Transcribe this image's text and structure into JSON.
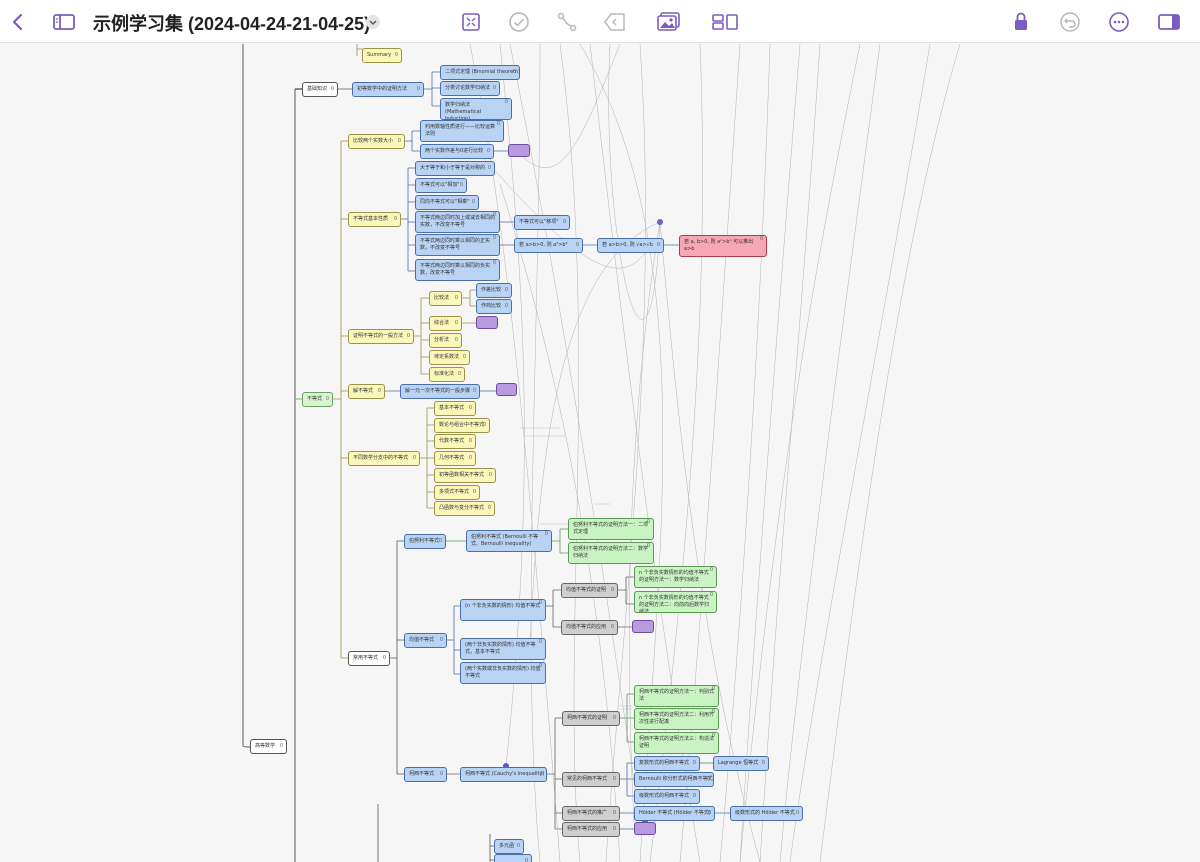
{
  "toolbar": {
    "title": "示例学习集 (2024-04-24-21-04-25)",
    "icons": [
      "chevron-left-icon",
      "sidebar-icon",
      "chevron-down-icon",
      "collapse-icon",
      "check-icon",
      "connect-icon",
      "back-icon",
      "image-icon",
      "layout-icon",
      "lock-icon",
      "undo-icon",
      "more-icon",
      "panel-icon"
    ],
    "accent": "#7b5cc4"
  },
  "nodes": [
    {
      "id": "summary",
      "label": "Summary",
      "count": "0",
      "color": "yellow"
    },
    {
      "id": "basic",
      "label": "基础知识",
      "count": "0",
      "color": "white"
    },
    {
      "id": "proofmethods",
      "label": "初等数学中的证明方法",
      "count": "0",
      "color": "blue"
    },
    {
      "id": "binomial",
      "label": "二项式定理 (Binomial theorem)",
      "count": "0",
      "color": "blue"
    },
    {
      "id": "mathind_list",
      "label": "分类讨论数学归纳法",
      "count": "0",
      "color": "blue"
    },
    {
      "id": "mathind",
      "label": "数学归纳法 (Mathematical induction)",
      "count": "0",
      "color": "blue"
    },
    {
      "id": "compare",
      "label": "比较两个实数大小",
      "count": "0",
      "color": "yellow"
    },
    {
      "id": "cmp1",
      "label": "利用数轴性质进行——比较运算法则",
      "count": "0",
      "color": "blue"
    },
    {
      "id": "cmp2",
      "label": "两个实数作差与0进行比较",
      "count": "0",
      "color": "blue"
    },
    {
      "id": "prop",
      "label": "不等式基本性质",
      "count": "0",
      "color": "yellow"
    },
    {
      "id": "p1",
      "label": "大于等于和小于等于是对称的",
      "count": "0",
      "color": "blue"
    },
    {
      "id": "p2",
      "label": "不等式可以\"相加\"",
      "count": "0",
      "color": "blue"
    },
    {
      "id": "p3",
      "label": "同向不等式可以\"相乘\"",
      "count": "0",
      "color": "blue"
    },
    {
      "id": "p4",
      "label": "不等式两边同时加上或减去相同的实数，不改变不等号",
      "count": "0",
      "color": "blue"
    },
    {
      "id": "p4r",
      "label": "不等式可以\"移项\"",
      "count": "0",
      "color": "blue"
    },
    {
      "id": "p5",
      "label": "不等式两边同时乘以相同的正实数，不改变不等号",
      "count": "0",
      "color": "blue"
    },
    {
      "id": "p5a",
      "label": "若 a>b>0, 则 a²>b²",
      "count": "0",
      "color": "blue"
    },
    {
      "id": "p5b",
      "label": "若 a>b>0, 则 √a>√b",
      "count": "0",
      "color": "blue"
    },
    {
      "id": "p5c",
      "label": "若 a, b>0, 则 aⁿ>bⁿ 可以推出 a>b",
      "count": "0",
      "color": "pink"
    },
    {
      "id": "p6",
      "label": "不等式两边同时乘以相同的负实数，改变不等号",
      "count": "0",
      "color": "blue"
    },
    {
      "id": "general",
      "label": "证明不等式的一般方法",
      "count": "0",
      "color": "yellow"
    },
    {
      "id": "g1",
      "label": "比较法",
      "count": "0",
      "color": "yellow"
    },
    {
      "id": "g1a",
      "label": "作差比较",
      "count": "0",
      "color": "blue"
    },
    {
      "id": "g1b",
      "label": "作商比较",
      "count": "0",
      "color": "blue"
    },
    {
      "id": "g2",
      "label": "综合法",
      "count": "0",
      "color": "yellow"
    },
    {
      "id": "g3",
      "label": "分析法",
      "count": "0",
      "color": "yellow"
    },
    {
      "id": "g4",
      "label": "待定系数法",
      "count": "0",
      "color": "yellow"
    },
    {
      "id": "g5",
      "label": "标准化法",
      "count": "0",
      "color": "yellow"
    },
    {
      "id": "ineq",
      "label": "不等式",
      "count": "0",
      "color": "lgreen"
    },
    {
      "id": "solve",
      "label": "解不等式",
      "count": "0",
      "color": "yellow"
    },
    {
      "id": "solve1",
      "label": "解一元一次不等式的一般步骤",
      "count": "0",
      "color": "blue"
    },
    {
      "id": "branches",
      "label": "不同数学分支中的不等式",
      "count": "0",
      "color": "yellow"
    },
    {
      "id": "b1",
      "label": "基本不等式",
      "count": "0",
      "color": "yellow"
    },
    {
      "id": "b2",
      "label": "数论与组合中不等式",
      "count": "0",
      "color": "yellow"
    },
    {
      "id": "b3",
      "label": "代数不等式",
      "count": "0",
      "color": "yellow"
    },
    {
      "id": "b4",
      "label": "几何不等式",
      "count": "0",
      "color": "yellow"
    },
    {
      "id": "b5",
      "label": "初等函数相关不等式",
      "count": "0",
      "color": "yellow"
    },
    {
      "id": "b6",
      "label": "多项式不等式",
      "count": "0",
      "color": "yellow"
    },
    {
      "id": "b7",
      "label": "凸函数与变分不等式",
      "count": "0",
      "color": "yellow"
    },
    {
      "id": "common",
      "label": "常用不等式",
      "count": "0",
      "color": "white"
    },
    {
      "id": "bern",
      "label": "伯努利不等式",
      "count": "0",
      "color": "blue"
    },
    {
      "id": "bern1",
      "label": "伯努利不等式 (Bernoulli 不等式、Bernoulli inequality)",
      "count": "0",
      "color": "blue"
    },
    {
      "id": "bern2",
      "label": "伯努利不等式的证明方法一：二项式定理",
      "count": "0",
      "color": "green"
    },
    {
      "id": "bern3",
      "label": "伯努利不等式的证明方法二：数学归纳法",
      "count": "0",
      "color": "green"
    },
    {
      "id": "mean",
      "label": "均值不等式",
      "count": "0",
      "color": "blue"
    },
    {
      "id": "mean1",
      "label": "(n 个非负实数的情形) 均值不等式",
      "count": "0",
      "color": "blue"
    },
    {
      "id": "mean2",
      "label": "(两个非负实数的情形) 均值不等式，基本不等式",
      "count": "0",
      "color": "blue"
    },
    {
      "id": "mean3",
      "label": "(两个实数或非负实数的情形) 均值不等式",
      "count": "0",
      "color": "blue"
    },
    {
      "id": "meanproof",
      "label": "均值不等式的证明",
      "count": "0",
      "color": "gray"
    },
    {
      "id": "meanp1",
      "label": "n 个非负实数情形的均值不等式的证明方法一：数学归纳法",
      "count": "0",
      "color": "green"
    },
    {
      "id": "meanp2",
      "label": "n 个非负实数情形的均值不等式的证明方法二：向前向后数学归纳法",
      "count": "0",
      "color": "green"
    },
    {
      "id": "meanapp",
      "label": "均值不等式的应用",
      "count": "0",
      "color": "gray"
    },
    {
      "id": "cauchy",
      "label": "柯西不等式",
      "count": "0",
      "color": "blue"
    },
    {
      "id": "cauchy1",
      "label": "柯西不等式 (Cauchy's inequality)",
      "count": "0",
      "color": "blue"
    },
    {
      "id": "cproof",
      "label": "柯西不等式的证明",
      "count": "0",
      "color": "gray"
    },
    {
      "id": "cp1",
      "label": "柯西不等式的证明方法一：判别式法",
      "count": "0",
      "color": "green"
    },
    {
      "id": "cp2",
      "label": "柯西不等式的证明方法二：利用齐次性进行配凑",
      "count": "0",
      "color": "green"
    },
    {
      "id": "cp3",
      "label": "柯西不等式的证明方法三：构造法证明",
      "count": "0",
      "color": "green"
    },
    {
      "id": "cvar",
      "label": "常见的柯西不等式",
      "count": "0",
      "color": "gray"
    },
    {
      "id": "cv1",
      "label": "复数形式的柯西不等式",
      "count": "0",
      "color": "blue"
    },
    {
      "id": "cv1a",
      "label": "Lagrange 恒等式",
      "count": "0",
      "color": "blue"
    },
    {
      "id": "cv2",
      "label": "Bernoulli 积分形式的柯西不等式",
      "count": "0",
      "color": "blue"
    },
    {
      "id": "cv3",
      "label": "级数形式的柯西不等式",
      "count": "0",
      "color": "blue"
    },
    {
      "id": "cgen",
      "label": "柯西不等式的推广",
      "count": "0",
      "color": "gray"
    },
    {
      "id": "cg1",
      "label": "Hölder 不等式 (Hölder 不等式)",
      "count": "0",
      "color": "blue"
    },
    {
      "id": "cg1a",
      "label": "级数形式的 Hölder 不等式",
      "count": "0",
      "color": "blue"
    },
    {
      "id": "capp",
      "label": "柯西不等式的应用",
      "count": "0",
      "color": "gray"
    },
    {
      "id": "adv",
      "label": "高等数学",
      "count": "0",
      "color": "white"
    },
    {
      "id": "b_xx1",
      "label": "多元函",
      "count": "0",
      "color": "blue"
    },
    {
      "id": "b_xx2",
      "label": "",
      "count": "0",
      "color": "blue"
    }
  ]
}
